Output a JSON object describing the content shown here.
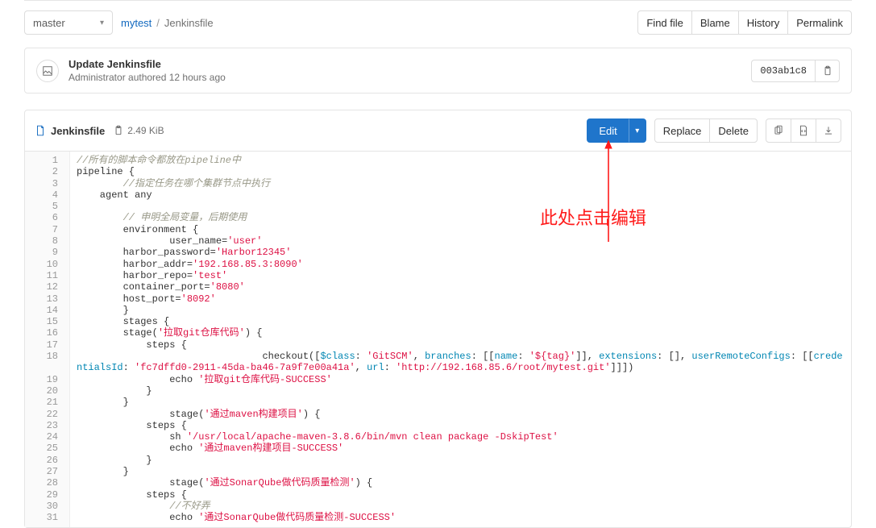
{
  "branch": {
    "selected": "master"
  },
  "breadcrumb": {
    "project": "mytest",
    "file": "Jenkinsfile"
  },
  "toolbar": {
    "find_file": "Find file",
    "blame": "Blame",
    "history": "History",
    "permalink": "Permalink"
  },
  "commit": {
    "title": "Update Jenkinsfile",
    "author": "Administrator",
    "action": "authored",
    "time": "12 hours ago",
    "sha_short": "003ab1c8"
  },
  "file": {
    "name": "Jenkinsfile",
    "size": "2.49 KiB",
    "edit_label": "Edit",
    "replace_label": "Replace",
    "delete_label": "Delete"
  },
  "code_lines": [
    {
      "n": 1,
      "segs": [
        [
          "c",
          "//所有的脚本命令都放在pipeline中"
        ]
      ]
    },
    {
      "n": 2,
      "segs": [
        [
          "p",
          "pipeline {"
        ]
      ]
    },
    {
      "n": 3,
      "segs": [
        [
          "p",
          "        "
        ],
        [
          "c",
          "//指定任务在哪个集群节点中执行"
        ]
      ]
    },
    {
      "n": 4,
      "segs": [
        [
          "p",
          "    agent any"
        ]
      ]
    },
    {
      "n": 5,
      "segs": [
        [
          "p",
          ""
        ]
      ]
    },
    {
      "n": 6,
      "segs": [
        [
          "p",
          "        "
        ],
        [
          "c",
          "// 申明全局变量，后期使用"
        ]
      ]
    },
    {
      "n": 7,
      "segs": [
        [
          "p",
          "        environment {"
        ]
      ]
    },
    {
      "n": 8,
      "segs": [
        [
          "p",
          "                user_name="
        ],
        [
          "s",
          "'user'"
        ]
      ]
    },
    {
      "n": 9,
      "segs": [
        [
          "p",
          "        harbor_password="
        ],
        [
          "s",
          "'Harbor12345'"
        ]
      ]
    },
    {
      "n": 10,
      "segs": [
        [
          "p",
          "        harbor_addr="
        ],
        [
          "s",
          "'192.168.85.3:8090'"
        ]
      ]
    },
    {
      "n": 11,
      "segs": [
        [
          "p",
          "        harbor_repo="
        ],
        [
          "s",
          "'test'"
        ]
      ]
    },
    {
      "n": 12,
      "segs": [
        [
          "p",
          "        container_port="
        ],
        [
          "s",
          "'8080'"
        ]
      ]
    },
    {
      "n": 13,
      "segs": [
        [
          "p",
          "        host_port="
        ],
        [
          "s",
          "'8092'"
        ]
      ]
    },
    {
      "n": 14,
      "segs": [
        [
          "p",
          "        }"
        ]
      ]
    },
    {
      "n": 15,
      "segs": [
        [
          "p",
          "        stages {"
        ]
      ]
    },
    {
      "n": 16,
      "segs": [
        [
          "p",
          "        stage("
        ],
        [
          "s",
          "'拉取git仓库代码'"
        ],
        [
          "p",
          ") {"
        ]
      ]
    },
    {
      "n": 17,
      "segs": [
        [
          "p",
          "            steps {"
        ]
      ]
    },
    {
      "n": 18,
      "wrap": true,
      "segs": [
        [
          "p",
          "                                checkout(["
        ],
        [
          "n",
          "$class"
        ],
        [
          "p",
          ": "
        ],
        [
          "s",
          "'GitSCM'"
        ],
        [
          "p",
          ", "
        ],
        [
          "n",
          "branches"
        ],
        [
          "p",
          ": [["
        ],
        [
          "n",
          "name"
        ],
        [
          "p",
          ": "
        ],
        [
          "s",
          "'${tag}'"
        ],
        [
          "p",
          "]], "
        ],
        [
          "n",
          "extensions"
        ],
        [
          "p",
          ": [], "
        ],
        [
          "n",
          "userRemoteConfigs"
        ],
        [
          "p",
          ": [["
        ],
        [
          "n",
          "credentialsId"
        ],
        [
          "p",
          ": "
        ],
        [
          "s",
          "'fc7dffd0-2911-45da-ba46-7a9f7e00a41a'"
        ],
        [
          "p",
          ", "
        ],
        [
          "n",
          "url"
        ],
        [
          "p",
          ": "
        ],
        [
          "s",
          "'http://192.168.85.6/root/mytest.git'"
        ],
        [
          "p",
          "]]])"
        ]
      ]
    },
    {
      "n": 19,
      "segs": [
        [
          "p",
          "                echo "
        ],
        [
          "s",
          "'拉取git仓库代码-SUCCESS'"
        ]
      ]
    },
    {
      "n": 20,
      "segs": [
        [
          "p",
          "            }"
        ]
      ]
    },
    {
      "n": 21,
      "segs": [
        [
          "p",
          "        }"
        ]
      ]
    },
    {
      "n": 22,
      "segs": [
        [
          "p",
          "                stage("
        ],
        [
          "s",
          "'通过maven构建项目'"
        ],
        [
          "p",
          ") {"
        ]
      ]
    },
    {
      "n": 23,
      "segs": [
        [
          "p",
          "            steps {"
        ]
      ]
    },
    {
      "n": 24,
      "segs": [
        [
          "p",
          "                sh "
        ],
        [
          "s",
          "'/usr/local/apache-maven-3.8.6/bin/mvn clean package -DskipTest'"
        ]
      ]
    },
    {
      "n": 25,
      "segs": [
        [
          "p",
          "                echo "
        ],
        [
          "s",
          "'通过maven构建项目-SUCCESS'"
        ]
      ]
    },
    {
      "n": 26,
      "segs": [
        [
          "p",
          "            }"
        ]
      ]
    },
    {
      "n": 27,
      "segs": [
        [
          "p",
          "        }"
        ]
      ]
    },
    {
      "n": 28,
      "segs": [
        [
          "p",
          "                stage("
        ],
        [
          "s",
          "'通过SonarQube做代码质量检测'"
        ],
        [
          "p",
          ") {"
        ]
      ]
    },
    {
      "n": 29,
      "segs": [
        [
          "p",
          "            steps {"
        ]
      ]
    },
    {
      "n": 30,
      "segs": [
        [
          "p",
          "                "
        ],
        [
          "c",
          "//不好弄"
        ]
      ]
    },
    {
      "n": 31,
      "segs": [
        [
          "p",
          "                echo "
        ],
        [
          "s",
          "'通过SonarQube做代码质量检测-SUCCESS'"
        ]
      ]
    }
  ],
  "annotation": {
    "text": "此处点击编辑"
  },
  "icons": {
    "doc": "doc-icon",
    "clip": "clipboard-icon",
    "copy": "copy-icon",
    "code": "code-icon",
    "download": "download-icon",
    "chevron_down": "▾"
  }
}
